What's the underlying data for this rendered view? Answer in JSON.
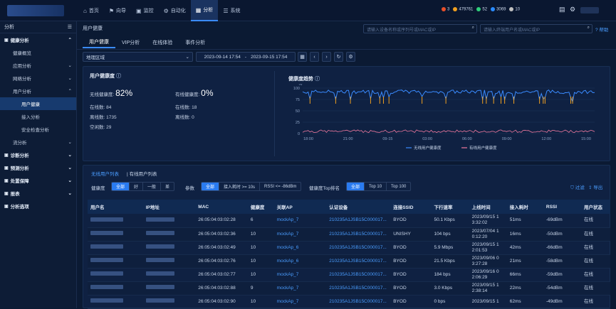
{
  "topnav": {
    "items": [
      {
        "icon": "⌂",
        "label": "首页"
      },
      {
        "icon": "⚑",
        "label": "向导"
      },
      {
        "icon": "▣",
        "label": "监控"
      },
      {
        "icon": "⚙",
        "label": "自动化"
      },
      {
        "icon": "▦",
        "label": "分析"
      },
      {
        "icon": "☰",
        "label": "系统"
      }
    ],
    "status": [
      {
        "color": "#e8502a",
        "value": "3"
      },
      {
        "color": "#f0a020",
        "value": "479761"
      },
      {
        "color": "#2fd07a",
        "value": "52"
      },
      {
        "color": "#2a8bff",
        "value": "3069"
      },
      {
        "color": "#c0c0c0",
        "value": "10"
      }
    ]
  },
  "sidebar": {
    "title": "分析",
    "items": [
      {
        "label": "健康分析",
        "level": 1,
        "arrow": "⌃"
      },
      {
        "label": "健康概览",
        "level": 2,
        "arrow": ""
      },
      {
        "label": "应用分析",
        "level": 2,
        "arrow": "⌄"
      },
      {
        "label": "网络分析",
        "level": 2,
        "arrow": "⌄"
      },
      {
        "label": "用户分析",
        "level": 2,
        "arrow": "⌃"
      },
      {
        "label": "用户健康",
        "level": 3,
        "arrow": "",
        "selected": true
      },
      {
        "label": "接入分析",
        "level": 3,
        "arrow": ""
      },
      {
        "label": "安全检查分析",
        "level": 3,
        "arrow": ""
      },
      {
        "label": "流分析",
        "level": 2,
        "arrow": "⌄"
      },
      {
        "label": "诊断分析",
        "level": 1,
        "arrow": "⌄"
      },
      {
        "label": "预测分析",
        "level": 1,
        "arrow": "⌄"
      },
      {
        "label": "处置保障",
        "level": 1,
        "arrow": "⌄"
      },
      {
        "label": "报表",
        "level": 1,
        "arrow": "⌄"
      },
      {
        "label": "分析选项",
        "level": 1,
        "arrow": ""
      }
    ]
  },
  "breadcrumb": "用户健康",
  "search": {
    "device_placeholder": "请输入设备名称或序列号或MAC或IP",
    "user_placeholder": "请输入终端用户名或MAC或IP",
    "help": "帮助"
  },
  "tabs": [
    "用户健康",
    "VIP分析",
    "在线体验",
    "事件分析"
  ],
  "filters": {
    "region": "地理区域",
    "date_start": "2023-09-14 17:54",
    "date_sep": "-",
    "date_end": "2023-09-15 17:54"
  },
  "health": {
    "title": "用户健康度",
    "wireless_label": "无线健康度:",
    "wireless_value": "82",
    "wireless_unit": "%",
    "wired_label": "有线健康度:",
    "wired_value": "0",
    "wired_unit": "%",
    "w_online": "在线数: 84",
    "w_offline": "离线数: 1735",
    "w_idle": "空闲数: 29",
    "l_online": "在线数: 18",
    "l_offline": "离线数: 0"
  },
  "trend": {
    "title": "健康度趋势",
    "unit": "%",
    "y_ticks": [
      "100",
      "75",
      "50",
      "25",
      "0"
    ],
    "x_ticks": [
      "18:00",
      "21:00",
      "09-15",
      "03:00",
      "06:00",
      "09:00",
      "12:00",
      "15:00"
    ],
    "legend": [
      "无线用户健康度",
      "有线用户健康度"
    ],
    "colors": {
      "wireless": "#3a8bff",
      "wired": "#f07aa0",
      "dip": "#f0a020"
    }
  },
  "list": {
    "tabs": [
      "无线用户列表",
      "有线用户列表"
    ],
    "health_label": "健康度",
    "health_opts": [
      "全部",
      "好",
      "一般",
      "差"
    ],
    "param_label": "参数",
    "param_opts": [
      "全部",
      "接入耗时 >= 10s",
      "RSSI <= -86dBm"
    ],
    "top_label": "健康度Top排名",
    "top_opts": [
      "全部",
      "Top 10",
      "Top 100"
    ],
    "filter_btn": "过滤",
    "export_btn": "导出"
  },
  "table": {
    "headers": [
      "用户名",
      "IP地址",
      "MAC",
      "健康度",
      "关联AP",
      "认证设备",
      "连接SSID",
      "下行速率",
      "上线时间",
      "接入耗时",
      "RSSI",
      "用户状态"
    ],
    "rows": [
      [
        "",
        "",
        "26:05:04:03:02:28",
        "6",
        "mockAp_7",
        "210235A1JSB15C000017...",
        "BYOD",
        "50.1 Kbps",
        "2023/09/15 1 3:32:02",
        "51ms",
        "-69dBm",
        "在线"
      ],
      [
        "",
        "",
        "26:05:04:03:02:36",
        "10",
        "mockAp_7",
        "210235A1JSB15C000017...",
        "UNISHY",
        "104 bps",
        "2023/07/04 1 0:12:20",
        "16ms",
        "-50dBm",
        "在线"
      ],
      [
        "",
        "",
        "26:05:04:03:02:49",
        "10",
        "mockAp_6",
        "210235A1JSB15C000017...",
        "BYOD",
        "5.9 Mbps",
        "2023/09/15 1 2:01:53",
        "42ms",
        "-66dBm",
        "在线"
      ],
      [
        "",
        "",
        "26:05:04:03:02:76",
        "10",
        "mockAp_6",
        "210235A1JSB15C000017...",
        "BYOD",
        "21.5 Kbps",
        "2023/09/06 0 3:27:28",
        "21ms",
        "-58dBm",
        "在线"
      ],
      [
        "",
        "",
        "26:05:04:03:02:77",
        "10",
        "mockAp_7",
        "210235A1JSB15C000017...",
        "BYOD",
        "184 bps",
        "2023/09/16 0 2:06:29",
        "66ms",
        "-59dBm",
        "在线"
      ],
      [
        "",
        "",
        "26:05:04:03:02:88",
        "9",
        "mockAp_7",
        "210235A1JSB15C000017...",
        "BYOD",
        "3.0 Kbps",
        "2023/09/15 1 2:38:14",
        "22ms",
        "-54dBm",
        "在线"
      ],
      [
        "",
        "",
        "26:05:04:03:02:90",
        "10",
        "mockAp_7",
        "210235A1JSB15C000017...",
        "BYOD",
        "0 bps",
        "2023/09/15 1",
        "62ms",
        "-49dBm",
        "在线"
      ]
    ]
  }
}
